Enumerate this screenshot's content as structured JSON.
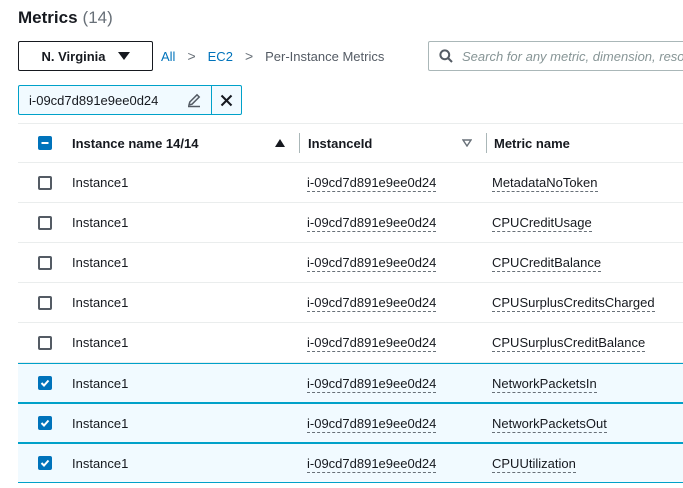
{
  "header": {
    "title": "Metrics",
    "count": "(14)"
  },
  "region": {
    "label": "N. Virginia"
  },
  "breadcrumb": {
    "items": [
      "All",
      "EC2",
      "Per-Instance Metrics"
    ]
  },
  "search": {
    "placeholder": "Search for any metric, dimension, resource id"
  },
  "filter_token": {
    "value": "i-09cd7d891e9ee0d24"
  },
  "table": {
    "columns": [
      "Instance name 14/14",
      "InstanceId",
      "Metric name"
    ],
    "rows": [
      {
        "name": "Instance1",
        "instance_id": "i-09cd7d891e9ee0d24",
        "metric": "MetadataNoToken",
        "checked": false
      },
      {
        "name": "Instance1",
        "instance_id": "i-09cd7d891e9ee0d24",
        "metric": "CPUCreditUsage",
        "checked": false
      },
      {
        "name": "Instance1",
        "instance_id": "i-09cd7d891e9ee0d24",
        "metric": "CPUCreditBalance",
        "checked": false
      },
      {
        "name": "Instance1",
        "instance_id": "i-09cd7d891e9ee0d24",
        "metric": "CPUSurplusCreditsCharged",
        "checked": false
      },
      {
        "name": "Instance1",
        "instance_id": "i-09cd7d891e9ee0d24",
        "metric": "CPUSurplusCreditBalance",
        "checked": false
      },
      {
        "name": "Instance1",
        "instance_id": "i-09cd7d891e9ee0d24",
        "metric": "NetworkPacketsIn",
        "checked": true
      },
      {
        "name": "Instance1",
        "instance_id": "i-09cd7d891e9ee0d24",
        "metric": "NetworkPacketsOut",
        "checked": true
      },
      {
        "name": "Instance1",
        "instance_id": "i-09cd7d891e9ee0d24",
        "metric": "CPUUtilization",
        "checked": true
      }
    ]
  },
  "colors": {
    "accent": "#0073bb",
    "selected_bg": "#f1faff",
    "selected_border": "#00a1c9",
    "text": "#16191f"
  },
  "icons": {
    "sort_asc": "triangle-up-icon",
    "sort_desc": "triangle-down-outline-icon",
    "search": "search-icon",
    "edit": "pencil-icon",
    "close": "close-icon",
    "dropdown": "caret-down-icon"
  }
}
